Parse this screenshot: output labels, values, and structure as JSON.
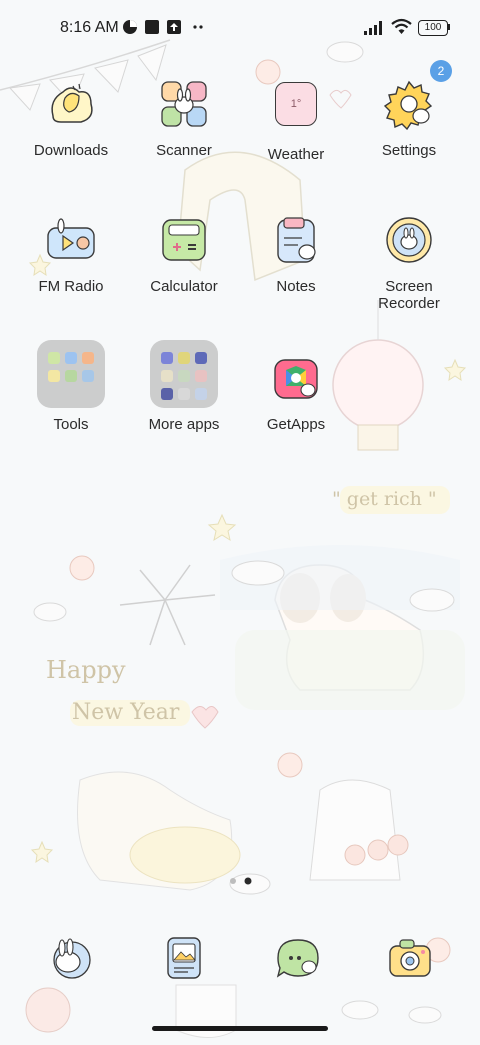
{
  "status_bar": {
    "time": "8:16 AM",
    "battery": "100",
    "icons": [
      "data-saver-icon",
      "square-app-icon",
      "upload-icon",
      "more-dots-icon",
      "signal-icon",
      "wifi-icon",
      "battery-icon"
    ]
  },
  "home": {
    "rows": [
      [
        {
          "label": "Downloads",
          "icon": "downloads-icon"
        },
        {
          "label": "Scanner",
          "icon": "scanner-icon"
        },
        {
          "label": "Weather",
          "icon": "weather-icon"
        },
        {
          "label": "Settings",
          "icon": "settings-icon",
          "badge": "2"
        }
      ],
      [
        {
          "label": "FM Radio",
          "icon": "radio-icon"
        },
        {
          "label": "Calculator",
          "icon": "calculator-icon"
        },
        {
          "label": "Notes",
          "icon": "notes-icon"
        },
        {
          "label": "Screen\nRecorder",
          "icon": "screen-recorder-icon"
        }
      ],
      [
        {
          "label": "Tools",
          "icon": "folder-icon"
        },
        {
          "label": "More apps",
          "icon": "folder-icon"
        },
        {
          "label": "GetApps",
          "icon": "getapps-icon"
        }
      ]
    ]
  },
  "weather_icon_text": "1°",
  "wallpaper_text": {
    "get_rich": "\" get rich \"",
    "happy": "Happy",
    "new_year": "New Year"
  },
  "dock": [
    {
      "icon": "phone-bunny-icon"
    },
    {
      "icon": "gallery-icon"
    },
    {
      "icon": "messages-icon"
    },
    {
      "icon": "camera-icon"
    }
  ],
  "colors": {
    "background": "#f7f9fa",
    "badge": "#5aa0e6",
    "label": "#2b2b2b"
  }
}
